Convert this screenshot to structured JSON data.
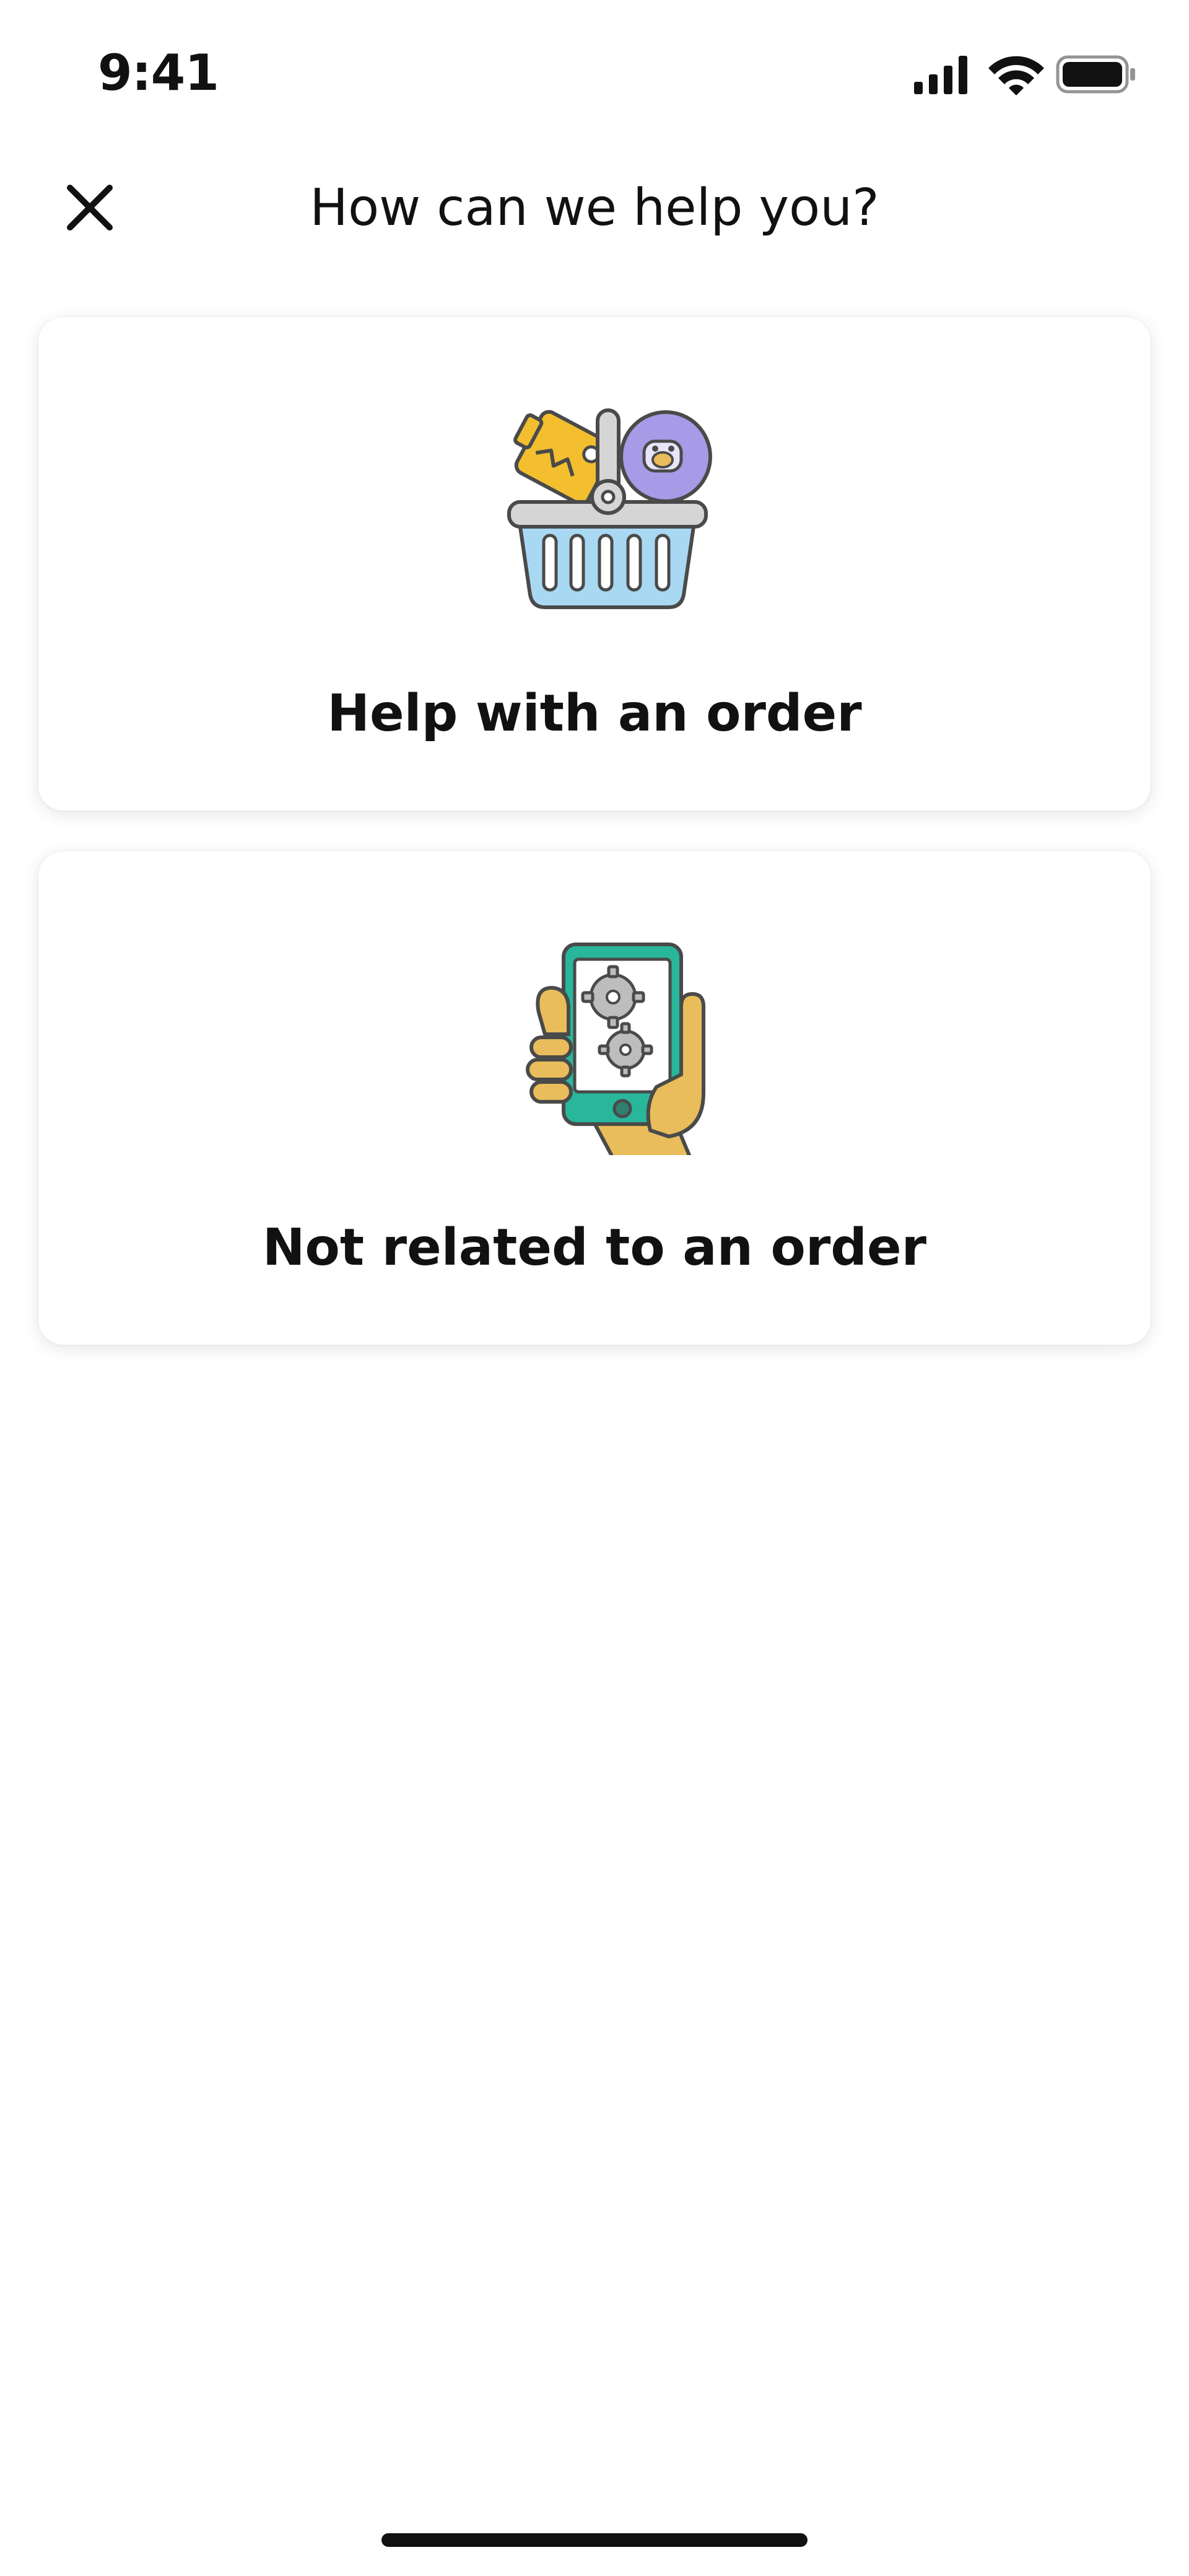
{
  "status_bar": {
    "time": "9:41",
    "signal_icon": "cellular-signal-icon",
    "wifi_icon": "wifi-icon",
    "battery_icon": "battery-icon"
  },
  "header": {
    "title": "How can we help you?",
    "close_icon": "close-icon"
  },
  "options": [
    {
      "label": "Help with an order",
      "icon": "shopping-basket-icon"
    },
    {
      "label": "Not related to an order",
      "icon": "phone-in-hand-icon"
    }
  ],
  "colors": {
    "basket_blue": "#a9d8f2",
    "toy_yellow": "#f3bf2f",
    "toy_purple": "#a79ae6",
    "phone_teal": "#28b79a",
    "hand_gold": "#e9bd5b",
    "outline": "#4a4a4a"
  }
}
